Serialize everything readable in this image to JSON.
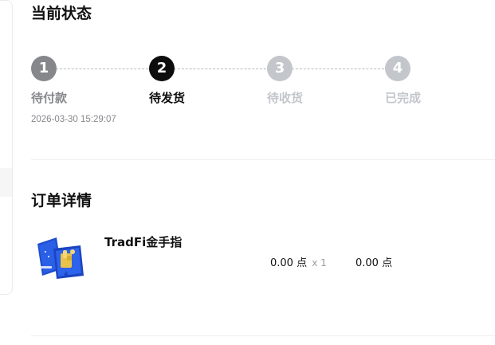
{
  "status_section": {
    "title": "当前状态",
    "steps": [
      {
        "number": "1",
        "label": "待付款",
        "state": "done"
      },
      {
        "number": "2",
        "label": "待发货",
        "state": "active"
      },
      {
        "number": "3",
        "label": "待收货",
        "state": "pending"
      },
      {
        "number": "4",
        "label": "已完成",
        "state": "pending"
      }
    ],
    "payment_time": "2026-03-30 15:29:07"
  },
  "order_detail": {
    "title": "订单详情",
    "items": [
      {
        "name": "TradFi金手指",
        "unit_price": "0.00",
        "unit": "点",
        "quantity_text": "x 1",
        "subtotal": "0.00",
        "subtotal_unit": "点",
        "image_icon": "gold-finger-product-image"
      }
    ]
  },
  "colors": {
    "step_done": "#85878a",
    "step_active": "#0d0d0d",
    "step_pending": "#c3c6cb",
    "product_blue": "#1f4fd1",
    "product_gold": "#e9c34a"
  }
}
